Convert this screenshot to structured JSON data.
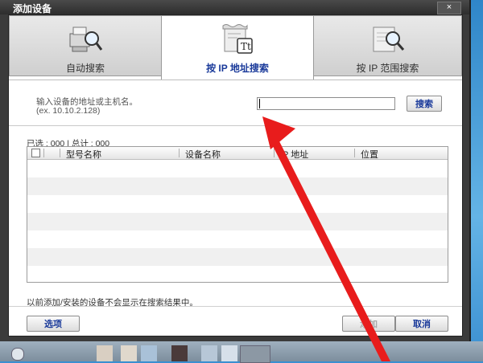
{
  "window": {
    "title": "添加设备",
    "close_label": "×"
  },
  "tabs": [
    {
      "label": "自动搜索",
      "active": false,
      "icon": "printer-magnifier-icon"
    },
    {
      "label": "按 IP 地址搜索",
      "active": true,
      "icon": "text-document-icon"
    },
    {
      "label": "按 IP 范围搜索",
      "active": false,
      "icon": "document-magnifier-icon"
    }
  ],
  "search": {
    "instruction": "输入设备的地址或主机名。",
    "example": "(ex. 10.10.2.128)",
    "ip_value": "",
    "button_label": "搜索"
  },
  "counts": "已选 : 000 | 总计 : 000",
  "table": {
    "columns": [
      "型号名称",
      "设备名称",
      "IP 地址",
      "位置"
    ],
    "rows": []
  },
  "note": "以前添加/安装的设备不会显示在搜索结果中。",
  "buttons": {
    "options": "选项",
    "add": "添加",
    "cancel": "取消"
  },
  "colors": {
    "accent_text": "#1a3a9a",
    "arrow": "#e81c1c",
    "title_bar": "#2d2d2d"
  }
}
